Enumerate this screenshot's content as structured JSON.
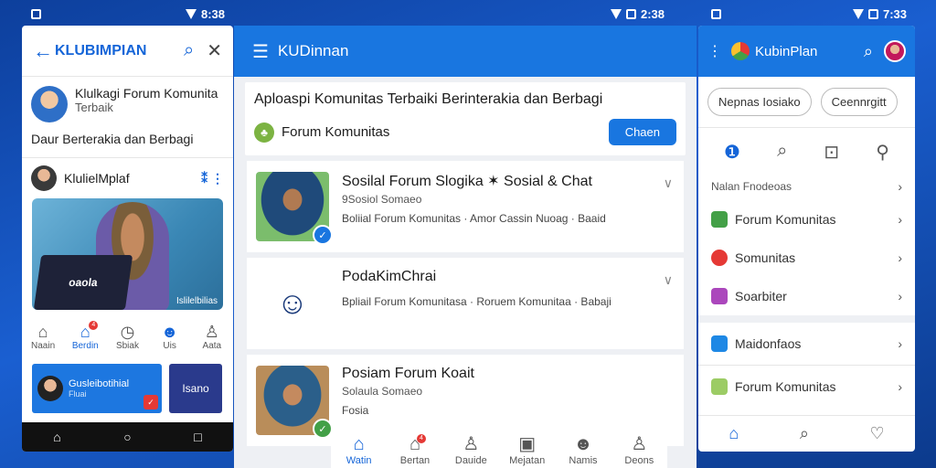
{
  "status_bars": [
    {
      "time": "8:38"
    },
    {
      "time": "2:38"
    },
    {
      "time": "7:33"
    }
  ],
  "left": {
    "app_title": "KLUBIMPIAN",
    "profile_name": "Klulkagi Forum Komunita",
    "profile_sub": "Terbaik",
    "tagline": "Daur Berterakia dan Berbagi",
    "poster_name": "KlulielMplaf",
    "photo_laptop_text": "oaola",
    "photo_caption": "Islilelbilias",
    "nav": [
      {
        "label": "Naain",
        "icon": "home-icon",
        "active": false
      },
      {
        "label": "Berdin",
        "icon": "home-icon",
        "active": true,
        "badge": "4"
      },
      {
        "label": "Sbiak",
        "icon": "clock-icon",
        "active": false
      },
      {
        "label": "Uis",
        "icon": "chat-icon",
        "active": false
      },
      {
        "label": "Aata",
        "icon": "person-icon",
        "active": false
      }
    ],
    "card_a_text": "Gusleibotihial",
    "card_a_sub": "Fluai",
    "card_b_text": "Isano"
  },
  "center": {
    "app_title": "KUDinnan",
    "banner_text": "Aploaspi Komunitas Terbaiki Berinterakia dan Berbagi",
    "banner_forum": "Forum Komunitas",
    "banner_button": "Chaen",
    "posts": [
      {
        "title": "Sosilal Forum Slogika ✶ Sosial & Chat",
        "sub": "9Sosiol Somaeo",
        "meta": "Boliial Forum Komunitas · Amor Cassin Nuoag · Baaid"
      },
      {
        "title": "PodaKimChrai",
        "sub": "",
        "meta": "Bpliail Forum Komunitasa · Roruem Komunitaa · Babaji"
      },
      {
        "title": "Posiam Forum Koait",
        "sub": "Solaula Somaeo",
        "meta": "Fosia"
      }
    ],
    "nav": [
      {
        "label": "Watin",
        "icon": "home-icon",
        "active": true
      },
      {
        "label": "Bertan",
        "icon": "home-icon",
        "active": false,
        "badge": "4"
      },
      {
        "label": "Dauide",
        "icon": "person-icon",
        "active": false
      },
      {
        "label": "Mejatan",
        "icon": "calendar-icon",
        "active": false
      },
      {
        "label": "Namis",
        "icon": "chat-icon",
        "active": false
      },
      {
        "label": "Deons",
        "icon": "person-icon",
        "active": false
      }
    ]
  },
  "right": {
    "app_title": "KubinPlan",
    "chips": [
      "Nepnas Iosiako",
      "Ceennrgitt"
    ],
    "section_head": "Nalan Fnodeoas",
    "rows": [
      {
        "label": "Forum Komunitas",
        "color": "#43a047"
      },
      {
        "label": "Somunitas",
        "color": "#e53935"
      },
      {
        "label": "Soarbiter",
        "color": "#ab47bc"
      }
    ],
    "rows2": [
      {
        "label": "Maidonfaos",
        "color": "#1e88e5"
      },
      {
        "label": "Forum Komunitas",
        "color": "#9ccc65"
      }
    ]
  }
}
